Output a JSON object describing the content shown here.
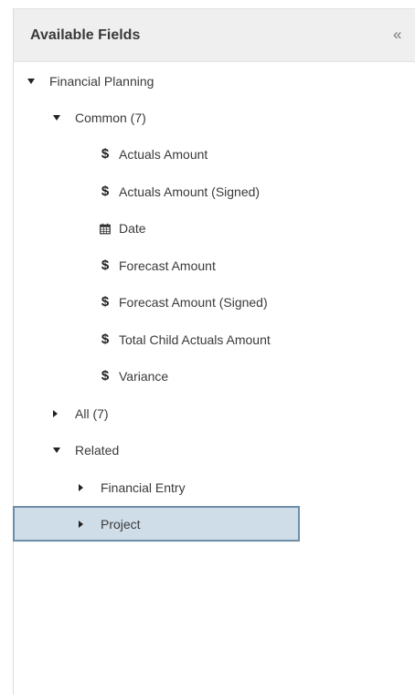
{
  "panel": {
    "title": "Available Fields",
    "collapse_glyph": "«"
  },
  "tree": {
    "root": {
      "label": "Financial Planning",
      "expanded": true
    },
    "common": {
      "label": "Common (7)",
      "expanded": true
    },
    "fields": [
      {
        "icon": "dollar-icon",
        "glyph": "$",
        "label": "Actuals Amount"
      },
      {
        "icon": "dollar-icon",
        "glyph": "$",
        "label": "Actuals Amount (Signed)"
      },
      {
        "icon": "calendar-icon",
        "glyph": "",
        "label": "Date"
      },
      {
        "icon": "dollar-icon",
        "glyph": "$",
        "label": "Forecast Amount"
      },
      {
        "icon": "dollar-icon",
        "glyph": "$",
        "label": "Forecast Amount (Signed)"
      },
      {
        "icon": "dollar-icon",
        "glyph": "$",
        "label": "Total Child Actuals Amount"
      },
      {
        "icon": "dollar-icon",
        "glyph": "$",
        "label": "Variance"
      }
    ],
    "all": {
      "label": "All (7)",
      "expanded": false
    },
    "related": {
      "label": "Related",
      "expanded": true
    },
    "related_items": [
      {
        "label": "Financial Entry",
        "expanded": false,
        "selected": false
      },
      {
        "label": "Project",
        "expanded": false,
        "selected": true
      }
    ]
  },
  "colors": {
    "header_bg": "#efefef",
    "selected_bg": "#cfdde8",
    "selected_border": "#6f8ea8"
  }
}
